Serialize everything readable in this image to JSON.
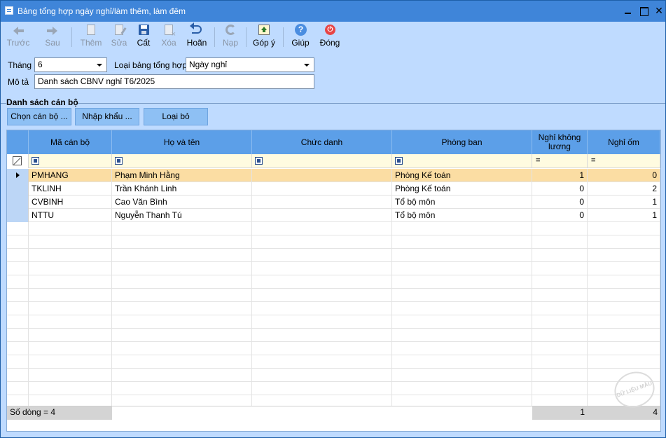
{
  "window": {
    "title": "Bảng tổng hợp ngày nghỉ/làm thêm, làm đêm"
  },
  "toolbar": {
    "prev": "Trước",
    "next": "Sau",
    "add": "Thêm",
    "edit": "Sửa",
    "save": "Cất",
    "delete": "Xóa",
    "undo": "Hoãn",
    "reload": "Nạp",
    "feedback": "Góp ý",
    "help": "Giúp",
    "close": "Đóng"
  },
  "form": {
    "month_label": "Tháng",
    "month_value": "6",
    "type_label": "Loại bảng tổng hợp",
    "type_value": "Ngày nghỉ",
    "desc_label": "Mô tả",
    "desc_value": "Danh sách CBNV nghỉ T6/2025"
  },
  "section": {
    "title": "Danh sách cán bộ",
    "buttons": {
      "choose": "Chọn cán bộ ...",
      "import": "Nhập khẩu ...",
      "remove": "Loại bỏ"
    }
  },
  "grid": {
    "columns": {
      "code": "Mã cán bộ",
      "name": "Họ và tên",
      "title": "Chức danh",
      "dept": "Phòng ban",
      "unpaid": "Nghỉ không lương",
      "sick": "Nghỉ ốm"
    },
    "rows": [
      {
        "code": "PMHANG",
        "name": "Phạm Minh Hằng",
        "title": "",
        "dept": "Phòng Kế toán",
        "unpaid": "1",
        "sick": "0"
      },
      {
        "code": "TKLINH",
        "name": "Trần Khánh Linh",
        "title": "",
        "dept": "Phòng Kế toán",
        "unpaid": "0",
        "sick": "2"
      },
      {
        "code": "CVBINH",
        "name": "Cao Văn Bình",
        "title": "",
        "dept": "Tổ bộ môn",
        "unpaid": "0",
        "sick": "1"
      },
      {
        "code": "NTTU",
        "name": "Nguyễn Thanh Tú",
        "title": "",
        "dept": "Tổ bộ môn",
        "unpaid": "0",
        "sick": "1"
      }
    ],
    "footer": {
      "count": "Số dòng = 4",
      "unpaid_total": "1",
      "sick_total": "4"
    }
  },
  "watermark": "DỮ LIỆU MẪU"
}
